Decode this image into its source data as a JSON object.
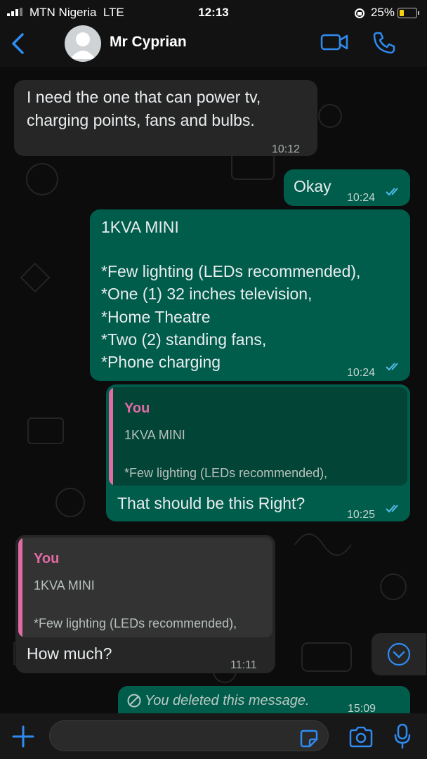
{
  "status_bar": {
    "carrier": "MTN Nigeria",
    "network": "LTE",
    "time": "12:13",
    "battery": "25%"
  },
  "header": {
    "contact_name": "Mr Cyprian"
  },
  "messages": [
    {
      "dir": "in",
      "lines": [
        "I need the one that can power tv,",
        "charging points, fans and bulbs."
      ],
      "time": "10:12"
    },
    {
      "dir": "out",
      "lines": [
        "Okay"
      ],
      "time": "10:24",
      "read": true
    },
    {
      "dir": "out",
      "lines": [
        "1KVA MINI",
        "",
        "*Few lighting (LEDs recommended),",
        "*One (1) 32 inches television,",
        "*Home Theatre",
        "*Two (2) standing fans,",
        "*Phone charging"
      ],
      "time": "10:24",
      "read": true
    },
    {
      "dir": "out",
      "quote": {
        "author": "You",
        "line1": "1KVA MINI",
        "line2": "*Few lighting (LEDs recommended),"
      },
      "lines": [
        "That should be this Right?"
      ],
      "time": "10:25",
      "read": true
    },
    {
      "dir": "in",
      "quote": {
        "author": "You",
        "line1": "1KVA MINI",
        "line2": "*Few lighting (LEDs recommended),"
      },
      "lines": [
        "How much?"
      ],
      "time": "11:11"
    },
    {
      "dir": "out",
      "deleted": true,
      "lines": [
        "You deleted this message."
      ],
      "time": "15:09"
    }
  ],
  "colors": {
    "outgoing": "#005c4b",
    "incoming": "#262626",
    "accent": "#2f8bf1",
    "quote_author": "#e26aa5",
    "read_ticks": "#53bdeb"
  },
  "icons": [
    "back-chevron-icon",
    "video-call-icon",
    "voice-call-icon",
    "plus-icon",
    "sticker-icon",
    "camera-icon",
    "microphone-icon",
    "scroll-down-icon",
    "deleted-icon"
  ]
}
